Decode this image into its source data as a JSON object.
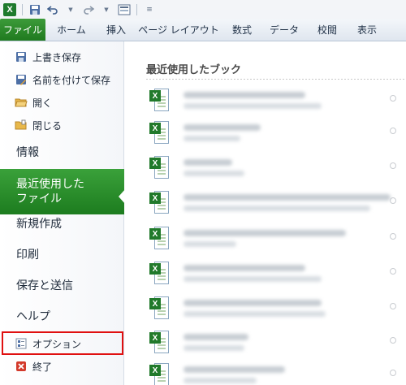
{
  "qat": {
    "icons": [
      "excel-app-icon",
      "save-icon",
      "undo-icon",
      "redo-icon",
      "form-icon",
      "customize-qat-icon"
    ]
  },
  "tabs": [
    "ファイル",
    "ホーム",
    "挿入",
    "ページ レイアウト",
    "数式",
    "データ",
    "校閲",
    "表示"
  ],
  "menu": {
    "commands_top": [
      "上書き保存",
      "名前を付けて保存",
      "開く",
      "閉じる"
    ],
    "sections": [
      "情報",
      "最近使用した ファイル",
      "新規作成",
      "印刷",
      "保存と送信",
      "ヘルプ"
    ],
    "active_section_line1": "最近使用した",
    "active_section_line2": "ファイル",
    "commands_bottom": [
      "オプション",
      "終了"
    ]
  },
  "colors": {
    "accent": "#2a8d2a",
    "highlight": "#e01010"
  },
  "content": {
    "heading": "最近使用したブック"
  }
}
